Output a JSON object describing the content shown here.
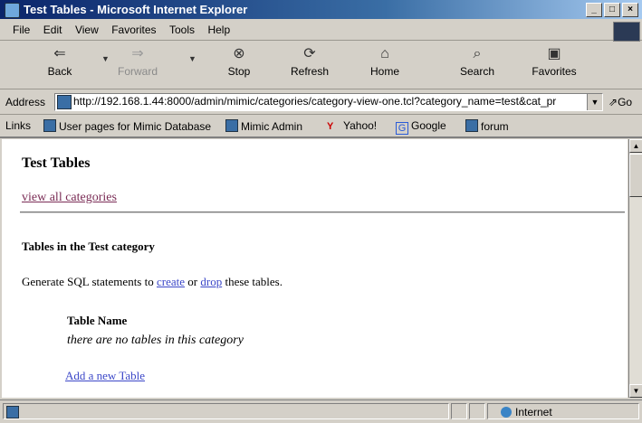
{
  "window": {
    "title": "Test Tables - Microsoft Internet Explorer"
  },
  "menu": [
    "File",
    "Edit",
    "View",
    "Favorites",
    "Tools",
    "Help"
  ],
  "toolbar": {
    "back": "Back",
    "forward": "Forward",
    "stop": "Stop",
    "refresh": "Refresh",
    "home": "Home",
    "search": "Search",
    "favorites": "Favorites"
  },
  "address": {
    "label": "Address",
    "url": "http://192.168.1.44:8000/admin/mimic/categories/category-view-one.tcl?category_name=test&cat_pr",
    "go": "Go"
  },
  "links": {
    "label": "Links",
    "items": [
      "User pages for Mimic Database",
      "Mimic Admin",
      "Yahoo!",
      "Google",
      "forum"
    ]
  },
  "page": {
    "title": "Test Tables",
    "view_all": "view all categories",
    "subheading": "Tables in the Test category",
    "gen_prefix": "Generate SQL statements to ",
    "gen_create": "create",
    "gen_or": " or ",
    "gen_drop": "drop",
    "gen_suffix": " these tables.",
    "table_header": "Table Name",
    "empty_msg": "there are no tables in this category",
    "add_link": "Add a new Table"
  },
  "status": {
    "zone": "Internet"
  }
}
